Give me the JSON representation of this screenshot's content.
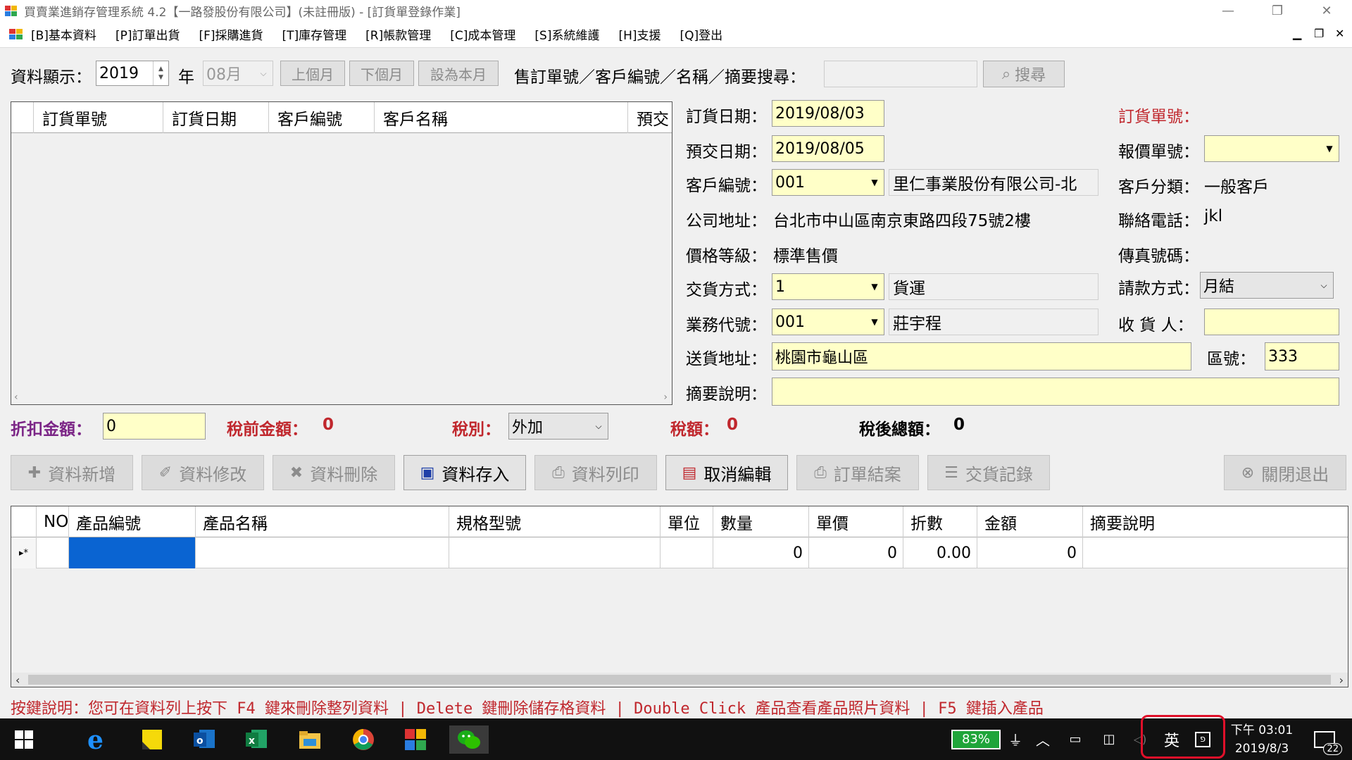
{
  "window": {
    "title": "買賣業進銷存管理系統 4.2【一路發股份有限公司】(未註冊版) - [訂貨單登錄作業]",
    "minimize": "—",
    "restore": "❐",
    "close": "✕"
  },
  "menu": {
    "items": [
      "[B]基本資料",
      "[P]訂單出貨",
      "[F]採購進貨",
      "[T]庫存管理",
      "[R]帳款管理",
      "[C]成本管理",
      "[S]系統維護",
      "[H]支援",
      "[Q]登出"
    ],
    "mdi_min": "▁",
    "mdi_restore": "❐",
    "mdi_close": "✕"
  },
  "toolbar": {
    "display_label": "資料顯示：",
    "year_value": "2019",
    "year_label": "年",
    "month_value": "08月",
    "prev_month": "上個月",
    "next_month": "下個月",
    "this_month": "設為本月",
    "search_label": "售訂單號／客戶編號／名稱／摘要搜尋：",
    "search_value": "",
    "search_button": "搜尋"
  },
  "list_grid": {
    "columns": [
      "訂貨單號",
      "訂貨日期",
      "客戶編號",
      "客戶名稱",
      "預交"
    ]
  },
  "form": {
    "order_date_label": "訂貨日期：",
    "order_date": "2019/08/03",
    "due_date_label": "預交日期：",
    "due_date": "2019/08/05",
    "customer_id_label": "客戶編號：",
    "customer_id": "001",
    "customer_name": "里仁事業股份有限公司-北",
    "address_label": "公司地址：",
    "address": "台北市中山區南京東路四段75號2樓",
    "price_level_label": "價格等級：",
    "price_level": "標準售價",
    "delivery_method_label": "交貨方式：",
    "delivery_method_code": "1",
    "delivery_method_name": "貨運",
    "sales_id_label": "業務代號：",
    "sales_id": "001",
    "sales_name": "莊宇程",
    "ship_address_label": "送貨地址：",
    "ship_address": "桃園市龜山區",
    "zip_label": "區號：",
    "zip": "333",
    "memo_label": "摘要說明：",
    "memo": "",
    "order_no_label": "訂貨單號：",
    "quote_no_label": "報價單號：",
    "customer_type_label": "客戶分類：",
    "customer_type": "一般客戶",
    "phone_label": "聯絡電話：",
    "phone": "jkl",
    "fax_label": "傳真號碼：",
    "billing_label": "請款方式：",
    "billing": "月結",
    "receiver_label": "收 貨 人：",
    "receiver": ""
  },
  "totals": {
    "discount_label": "折扣金額：",
    "discount": "0",
    "pretax_label": "稅前金額：",
    "pretax": "0",
    "tax_type_label": "稅別：",
    "tax_type": "外加",
    "tax_label": "稅額：",
    "tax": "0",
    "total_label": "稅後總額：",
    "total": "0"
  },
  "actions": {
    "add": "資料新增",
    "edit": "資料修改",
    "delete": "資料刪除",
    "save": "資料存入",
    "print": "資料列印",
    "cancel": "取消編輯",
    "close_order": "訂單結案",
    "delivery_log": "交貨記錄",
    "exit": "關閉退出"
  },
  "detail_grid": {
    "columns": [
      "NO",
      "產品編號",
      "產品名稱",
      "規格型號",
      "單位",
      "數量",
      "單價",
      "折數",
      "金額",
      "摘要說明"
    ],
    "row_marker": "▸*",
    "new_row": {
      "qty": "0",
      "price": "0",
      "discount": "0.00",
      "amount": "0"
    }
  },
  "help_text": "按鍵說明：您可在資料列上按下 F4 鍵來刪除整列資料 | Delete 鍵刪除儲存格資料 | Double Click 產品查看產品照片資料 | F5 鍵插入產品",
  "taskbar": {
    "battery": "83%",
    "ime": "英",
    "time": "下午 03:01",
    "date": "2019/8/3",
    "notifications": "22"
  },
  "colors": {
    "input_yellow": "#ffffc8",
    "label_red": "#c0272d",
    "label_purple": "#7b2586",
    "selection_blue": "#0a64d2",
    "battery_green": "#1fa53a"
  }
}
